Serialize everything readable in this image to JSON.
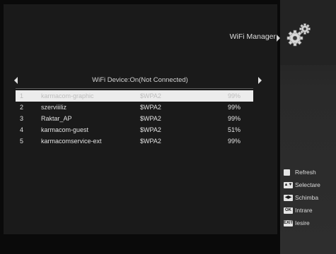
{
  "header": {
    "title": "WiFi Manager",
    "icon": "gear-icon"
  },
  "device": {
    "status": "WiFi Device:On(Not Connected)"
  },
  "networks": [
    {
      "num": "1",
      "name": "karmacom-graphic",
      "security": "$WPA2",
      "signal": "99%",
      "selected": true
    },
    {
      "num": "2",
      "name": "szerviiiliz",
      "security": "$WPA2",
      "signal": "99%",
      "selected": false
    },
    {
      "num": "3",
      "name": "Raktar_AP",
      "security": "$WPA2",
      "signal": "99%",
      "selected": false
    },
    {
      "num": "4",
      "name": "karmacom-guest",
      "security": "$WPA2",
      "signal": "51%",
      "selected": false
    },
    {
      "num": "5",
      "name": "karmacomservice-ext",
      "security": "$WPA2",
      "signal": "99%",
      "selected": false
    }
  ],
  "legend": [
    {
      "key": "",
      "label": "Refresh",
      "icon": "red-button-icon"
    },
    {
      "key": "▲▼",
      "label": "Selectare",
      "icon": "up-down-keys-icon"
    },
    {
      "key": "◀▶",
      "label": "Schimba",
      "icon": "left-right-keys-icon"
    },
    {
      "key": "OK",
      "label": "Intrare",
      "icon": "ok-key-icon"
    },
    {
      "key": "EXIT",
      "label": "Iesire",
      "icon": "exit-key-icon"
    }
  ]
}
